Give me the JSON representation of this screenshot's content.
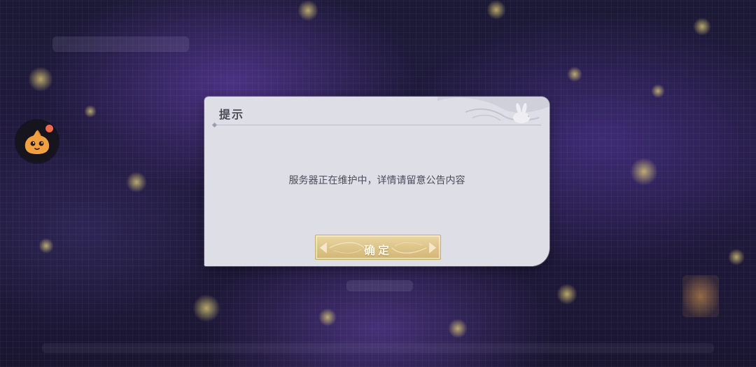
{
  "dialog": {
    "title": "提示",
    "message": "服务器正在维护中，详情请留意公告内容",
    "confirm_label": "确定"
  },
  "colors": {
    "dialog_bg": "#dedee6",
    "button_gold": "#dcc386",
    "assistant_orange": "#f0a040",
    "badge_red": "#f06a4a"
  },
  "icons": {
    "assistant": "floating-assistant-mascot-icon",
    "notification": "notification-dot-icon",
    "decoration": "rabbit-cloud-ornament-icon"
  }
}
